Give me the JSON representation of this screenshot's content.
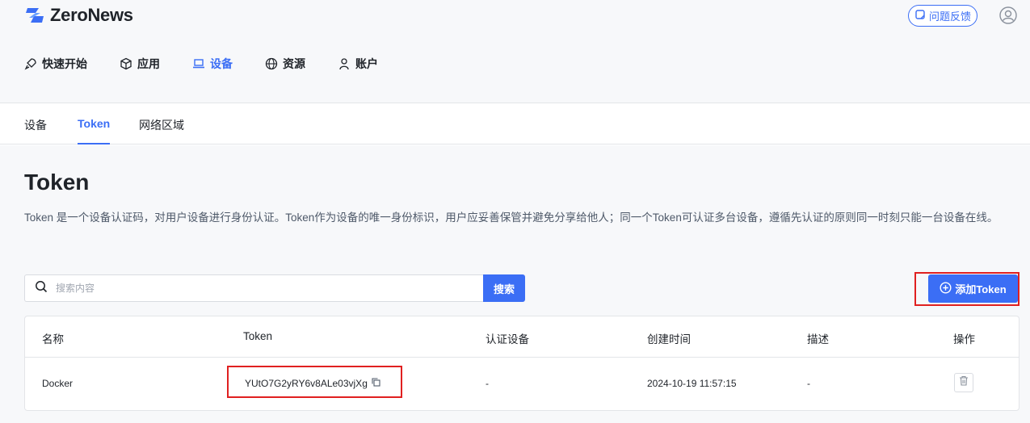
{
  "brand": {
    "name": "ZeroNews",
    "accent": "#3b6ef5"
  },
  "header": {
    "feedback_label": "问题反馈"
  },
  "nav": {
    "items": [
      {
        "label": "快速开始",
        "icon": "rocket-icon"
      },
      {
        "label": "应用",
        "icon": "cube-icon"
      },
      {
        "label": "设备",
        "icon": "laptop-icon",
        "active": true
      },
      {
        "label": "资源",
        "icon": "globe-icon"
      },
      {
        "label": "账户",
        "icon": "user-icon"
      }
    ]
  },
  "subnav": {
    "items": [
      {
        "label": "设备"
      },
      {
        "label": "Token",
        "active": true
      },
      {
        "label": "网络区域"
      }
    ]
  },
  "page": {
    "title": "Token",
    "description": "Token 是一个设备认证码，对用户设备进行身份认证。Token作为设备的唯一身份标识，用户应妥善保管并避免分享给他人；同一个Token可认证多台设备，遵循先认证的原则同一时刻只能一台设备在线。"
  },
  "search": {
    "placeholder": "搜索内容",
    "value": "",
    "button_label": "搜索"
  },
  "add_button_label": "添加Token",
  "table": {
    "columns": [
      "名称",
      "Token",
      "认证设备",
      "创建时间",
      "描述",
      "操作"
    ],
    "rows": [
      {
        "name": "Docker",
        "token": "YUtO7G2yRY6v8ALe03vjXg",
        "device": "-",
        "created": "2024-10-19 11:57:15",
        "desc": "-"
      }
    ]
  }
}
